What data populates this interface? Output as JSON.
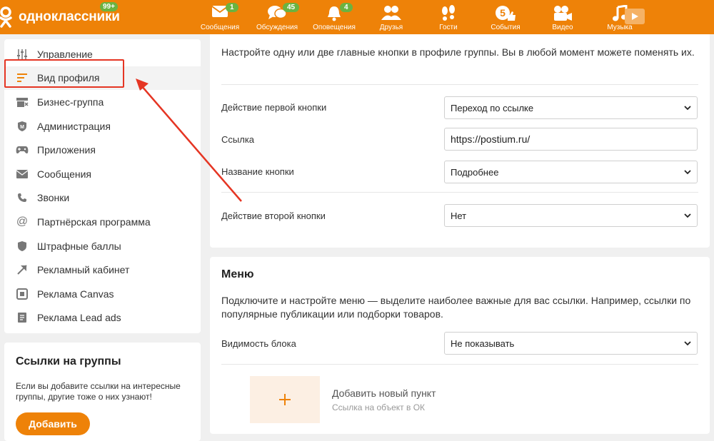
{
  "topbar": {
    "logo_text": "одноклассники",
    "logo_badge": "99+",
    "nav": [
      {
        "label": "Сообщения",
        "badge": "1",
        "icon": "envelope-icon"
      },
      {
        "label": "Обсуждения",
        "badge": "45",
        "icon": "chat-bubbles-icon"
      },
      {
        "label": "Оповещения",
        "badge": "4",
        "icon": "bell-icon"
      },
      {
        "label": "Друзья",
        "badge": "",
        "icon": "friends-icon"
      },
      {
        "label": "Гости",
        "badge": "",
        "icon": "footprints-icon"
      },
      {
        "label": "События",
        "badge": "",
        "icon": "events-icon"
      },
      {
        "label": "Видео",
        "badge": "",
        "icon": "video-camera-icon"
      },
      {
        "label": "Музыка",
        "badge": "",
        "icon": "music-note-icon"
      }
    ],
    "events_icon_number": "5"
  },
  "sidebar": {
    "items": [
      {
        "label": "Управление",
        "icon": "sliders-icon"
      },
      {
        "label": "Вид профиля",
        "icon": "profile-layout-icon",
        "active": true
      },
      {
        "label": "Бизнес-группа",
        "icon": "business-store-icon"
      },
      {
        "label": "Администрация",
        "icon": "shield-icon"
      },
      {
        "label": "Приложения",
        "icon": "gamepad-icon"
      },
      {
        "label": "Сообщения",
        "icon": "envelope-icon"
      },
      {
        "label": "Звонки",
        "icon": "phone-icon"
      },
      {
        "label": "Партнёрская программа",
        "icon": "at-sign-icon"
      },
      {
        "label": "Штрафные баллы",
        "icon": "shield-icon"
      },
      {
        "label": "Рекламный кабинет",
        "icon": "megaphone-icon"
      },
      {
        "label": "Реклама Canvas",
        "icon": "canvas-icon"
      },
      {
        "label": "Реклама Lead ads",
        "icon": "document-icon"
      }
    ]
  },
  "links_card": {
    "title": "Ссылки на группы",
    "text": "Если вы добавите ссылки на интересные группы, другие тоже о них узнают!",
    "button": "Добавить"
  },
  "buttons_card": {
    "intro": "Настройте одну или две главные кнопки в профиле группы. Вы в любой момент можете поменять их.",
    "first_action_label": "Действие первой кнопки",
    "first_action_value": "Переход по ссылке",
    "link_label": "Ссылка",
    "link_value": "https://postium.ru/",
    "button_name_label": "Название кнопки",
    "button_name_value": "Подробнее",
    "second_action_label": "Действие второй кнопки",
    "second_action_value": "Нет"
  },
  "menu_card": {
    "title": "Меню",
    "description": "Подключите и настройте меню — выделите наиболее важные для вас ссылки. Например, ссылки по популярные публикации или подборки товаров.",
    "visibility_label": "Видимость блока",
    "visibility_value": "Не показывать",
    "add_item_title": "Добавить новый пункт",
    "add_item_subtitle": "Ссылка на объект в ОК"
  },
  "colors": {
    "brand": "#ee8208",
    "badge": "#6bb340",
    "highlight": "#e53523"
  }
}
